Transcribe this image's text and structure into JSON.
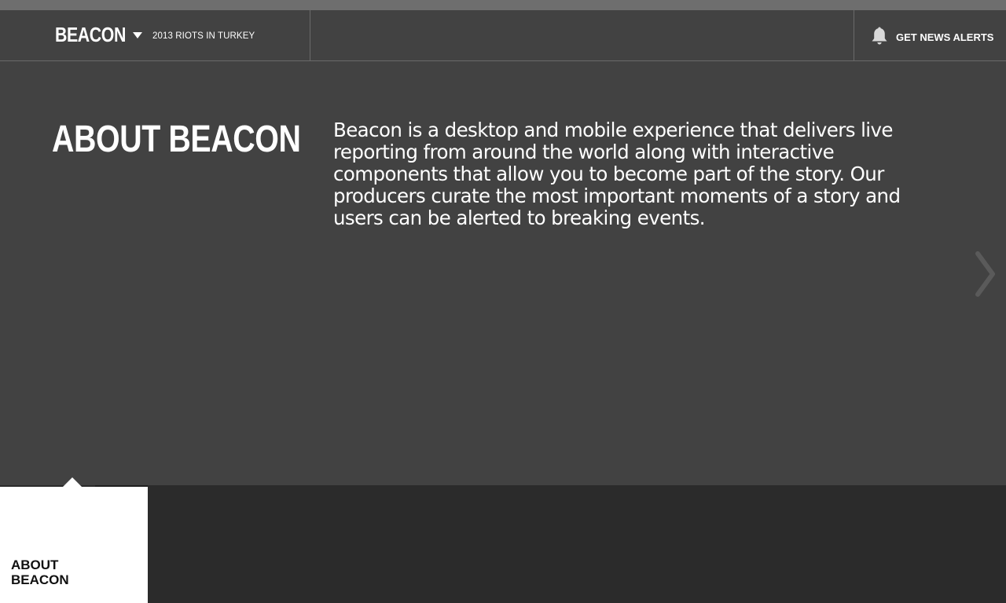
{
  "header": {
    "brand": "BEACON",
    "story_title": "2013 RIOTS IN TURKEY",
    "alerts_label": "GET NEWS ALERTS",
    "icons": {
      "brand_menu": "caret-down-icon",
      "alerts": "bell-icon"
    }
  },
  "main": {
    "heading": "ABOUT BEACON",
    "body": "Beacon is a desktop and mobile experience that delivers live reporting from around the world along with interactive components that allow you to become part of the story.  Our producers curate the most important moments of a story and users can be alerted to breaking events.",
    "next_icon": "chevron-right-icon"
  },
  "timeline": {
    "cards": [
      {
        "label_line1": "ABOUT",
        "label_line2": "BEACON",
        "active": true
      }
    ]
  },
  "colors": {
    "background": "#424242",
    "top_strip": "#6e6e6e",
    "bottom_bar": "#2b2b2b",
    "text": "#ffffff",
    "card_bg": "#ffffff",
    "card_text": "#111111"
  }
}
